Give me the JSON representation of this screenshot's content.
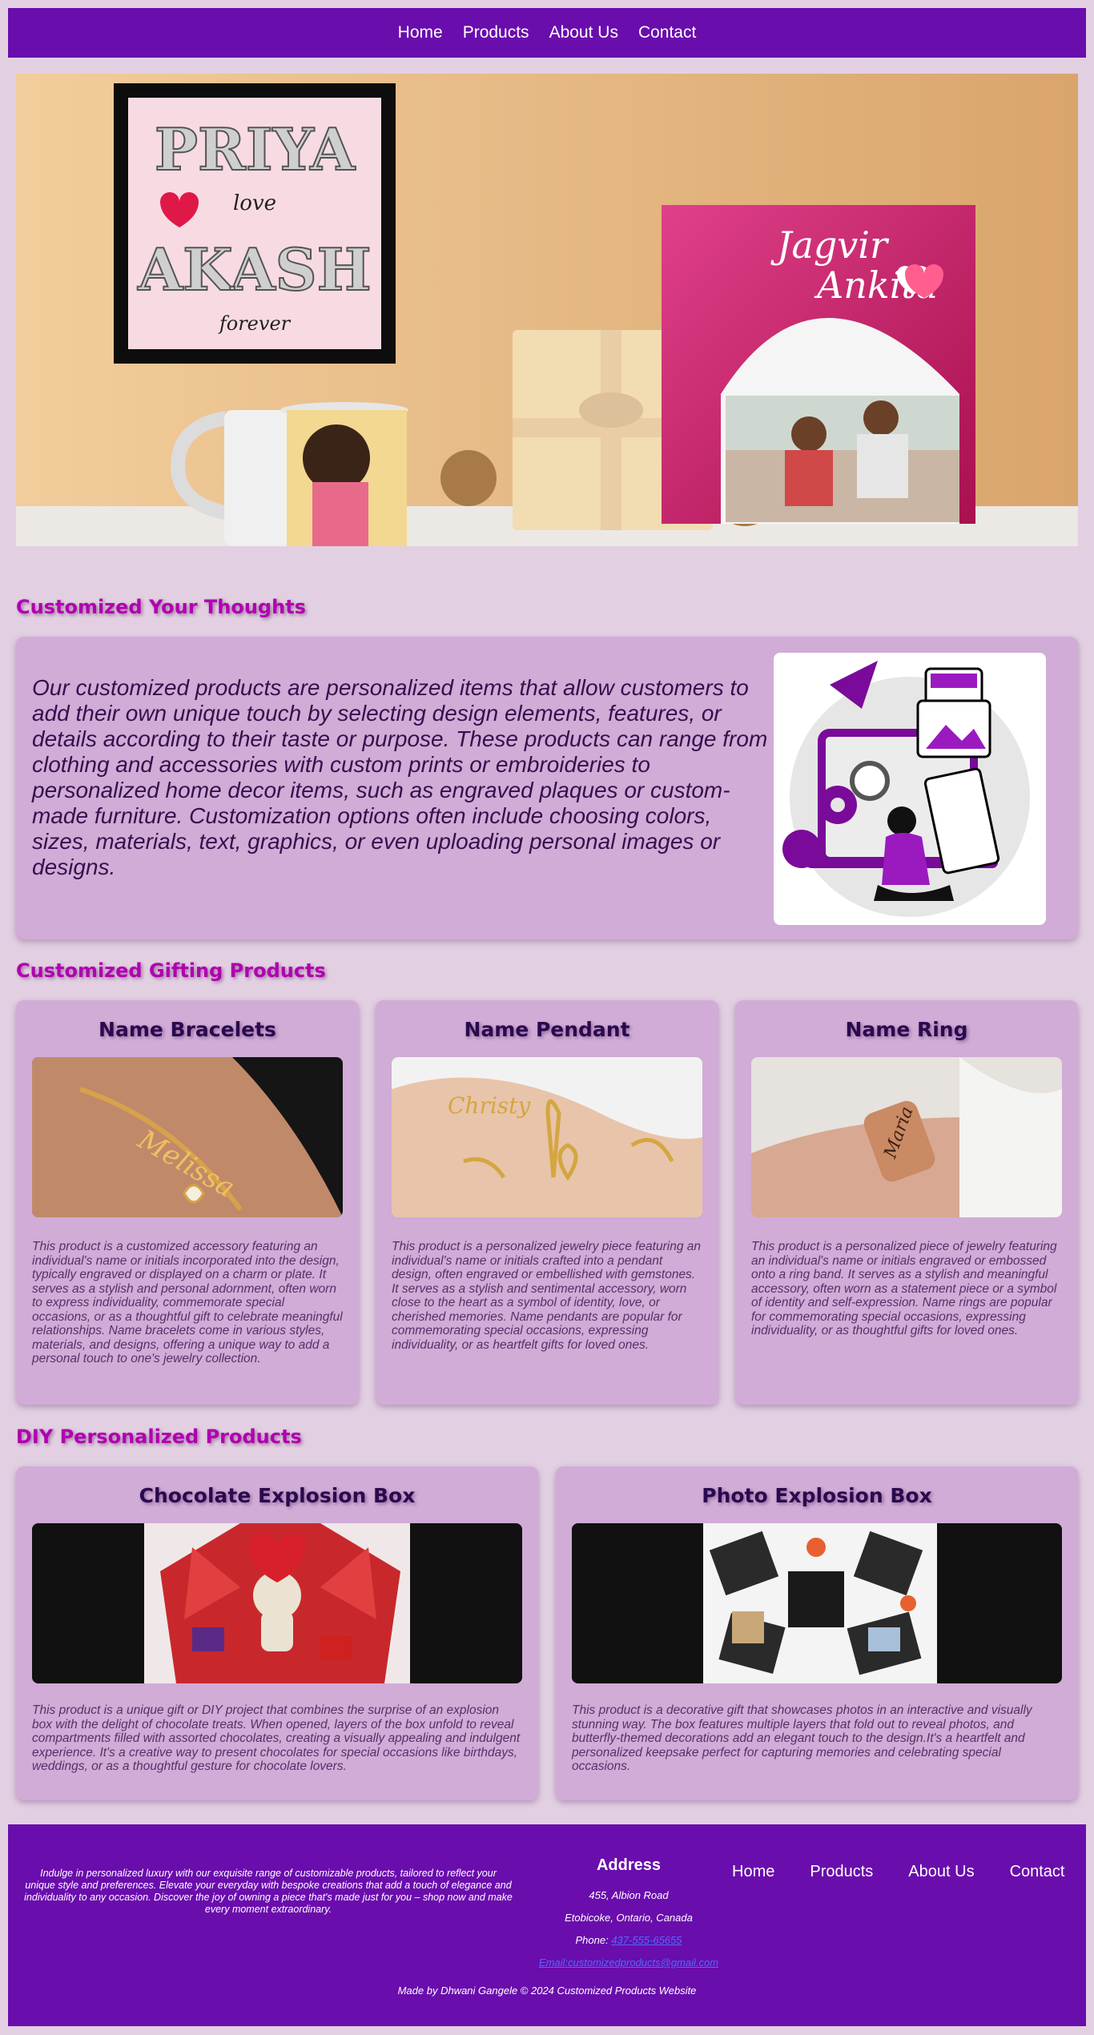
{
  "nav": {
    "items": [
      "Home",
      "Products",
      "About Us",
      "Contact"
    ]
  },
  "hero": {
    "frame_text_top": "PRIYA",
    "frame_text_mid": "love",
    "frame_text_bottom": "AKASH",
    "frame_text_end": "forever",
    "book_line1": "Jagvir",
    "book_line2": "Ankita"
  },
  "about": {
    "title": "Customized Your Thoughts",
    "text": "Our customized products are personalized items that allow customers to add their own unique touch by selecting design elements, features, or details according to their taste or purpose. These products can range from clothing and accessories with custom prints or embroideries to personalized home decor items, such as engraved plaques or custom-made furniture. Customization options often include choosing colors, sizes, materials, text, graphics, or even uploading personal images or designs."
  },
  "gifting": {
    "title": "Customized Gifting Products",
    "products": [
      {
        "name": "Name Bracelets",
        "engraving": "Melissa",
        "desc": "This product is a customized accessory featuring an individual's name or initials incorporated into the design, typically engraved or displayed on a charm or plate. It serves as a stylish and personal adornment, often worn to express individuality, commemorate special occasions, or as a thoughtful gift to celebrate meaningful relationships. Name bracelets come in various styles, materials, and designs, offering a unique way to add a personal touch to one's jewelry collection."
      },
      {
        "name": "Name Pendant",
        "engraving": "Christy",
        "desc": "This product is a personalized jewelry piece featuring an individual's name or initials crafted into a pendant design, often engraved or embellished with gemstones. It serves as a stylish and sentimental accessory, worn close to the heart as a symbol of identity, love, or cherished memories. Name pendants are popular for commemorating special occasions, expressing individuality, or as heartfelt gifts for loved ones."
      },
      {
        "name": "Name Ring",
        "engraving": "Maria",
        "desc": "This product is a personalized piece of jewelry featuring an individual's name or initials engraved or embossed onto a ring band. It serves as a stylish and meaningful accessory, often worn as a statement piece or a symbol of identity and self-expression. Name rings are popular for commemorating special occasions, expressing individuality, or as thoughtful gifts for loved ones."
      }
    ]
  },
  "diy": {
    "title": "DIY Personalized Products",
    "products": [
      {
        "name": "Chocolate Explosion Box",
        "desc": "This product is a unique gift or DIY project that combines the surprise of an explosion box with the delight of chocolate treats. When opened, layers of the box unfold to reveal compartments filled with assorted chocolates, creating a visually appealing and indulgent experience. It's a creative way to present chocolates for special occasions like birthdays, weddings, or as a thoughtful gesture for chocolate lovers."
      },
      {
        "name": "Photo Explosion Box",
        "desc": "This product is a decorative gift that showcases photos in an interactive and visually stunning way. The box features multiple layers that fold out to reveal photos, and butterfly-themed decorations add an elegant touch to the design.It's a heartfelt and personalized keepsake perfect for capturing memories and celebrating special occasions."
      }
    ]
  },
  "footer": {
    "text": "Indulge in personalized luxury with our exquisite range of customizable products, tailored to reflect your unique style and preferences. Elevate your everyday with bespoke creations that add a touch of elegance and individuality to any occasion. Discover the joy of owning a piece that's made just for you – shop now and make every moment extraordinary.",
    "address_title": "Address",
    "street": "455, Albion Road",
    "city": "Etobicoke, Ontario, Canada",
    "phone_label": "Phone: ",
    "phone": "437-555-65655",
    "email_label": "Email:",
    "email": "customizedproducts@gmail.com",
    "nav": [
      "Home",
      "Products",
      "About Us",
      "Contact"
    ],
    "copyright": "Made by Dhwani Gangele © 2024 Customized Products Website"
  },
  "colors": {
    "primary": "#6a0dad",
    "background": "#e2d0e2",
    "card": "#d0acd6",
    "accent": "#b000b0"
  }
}
